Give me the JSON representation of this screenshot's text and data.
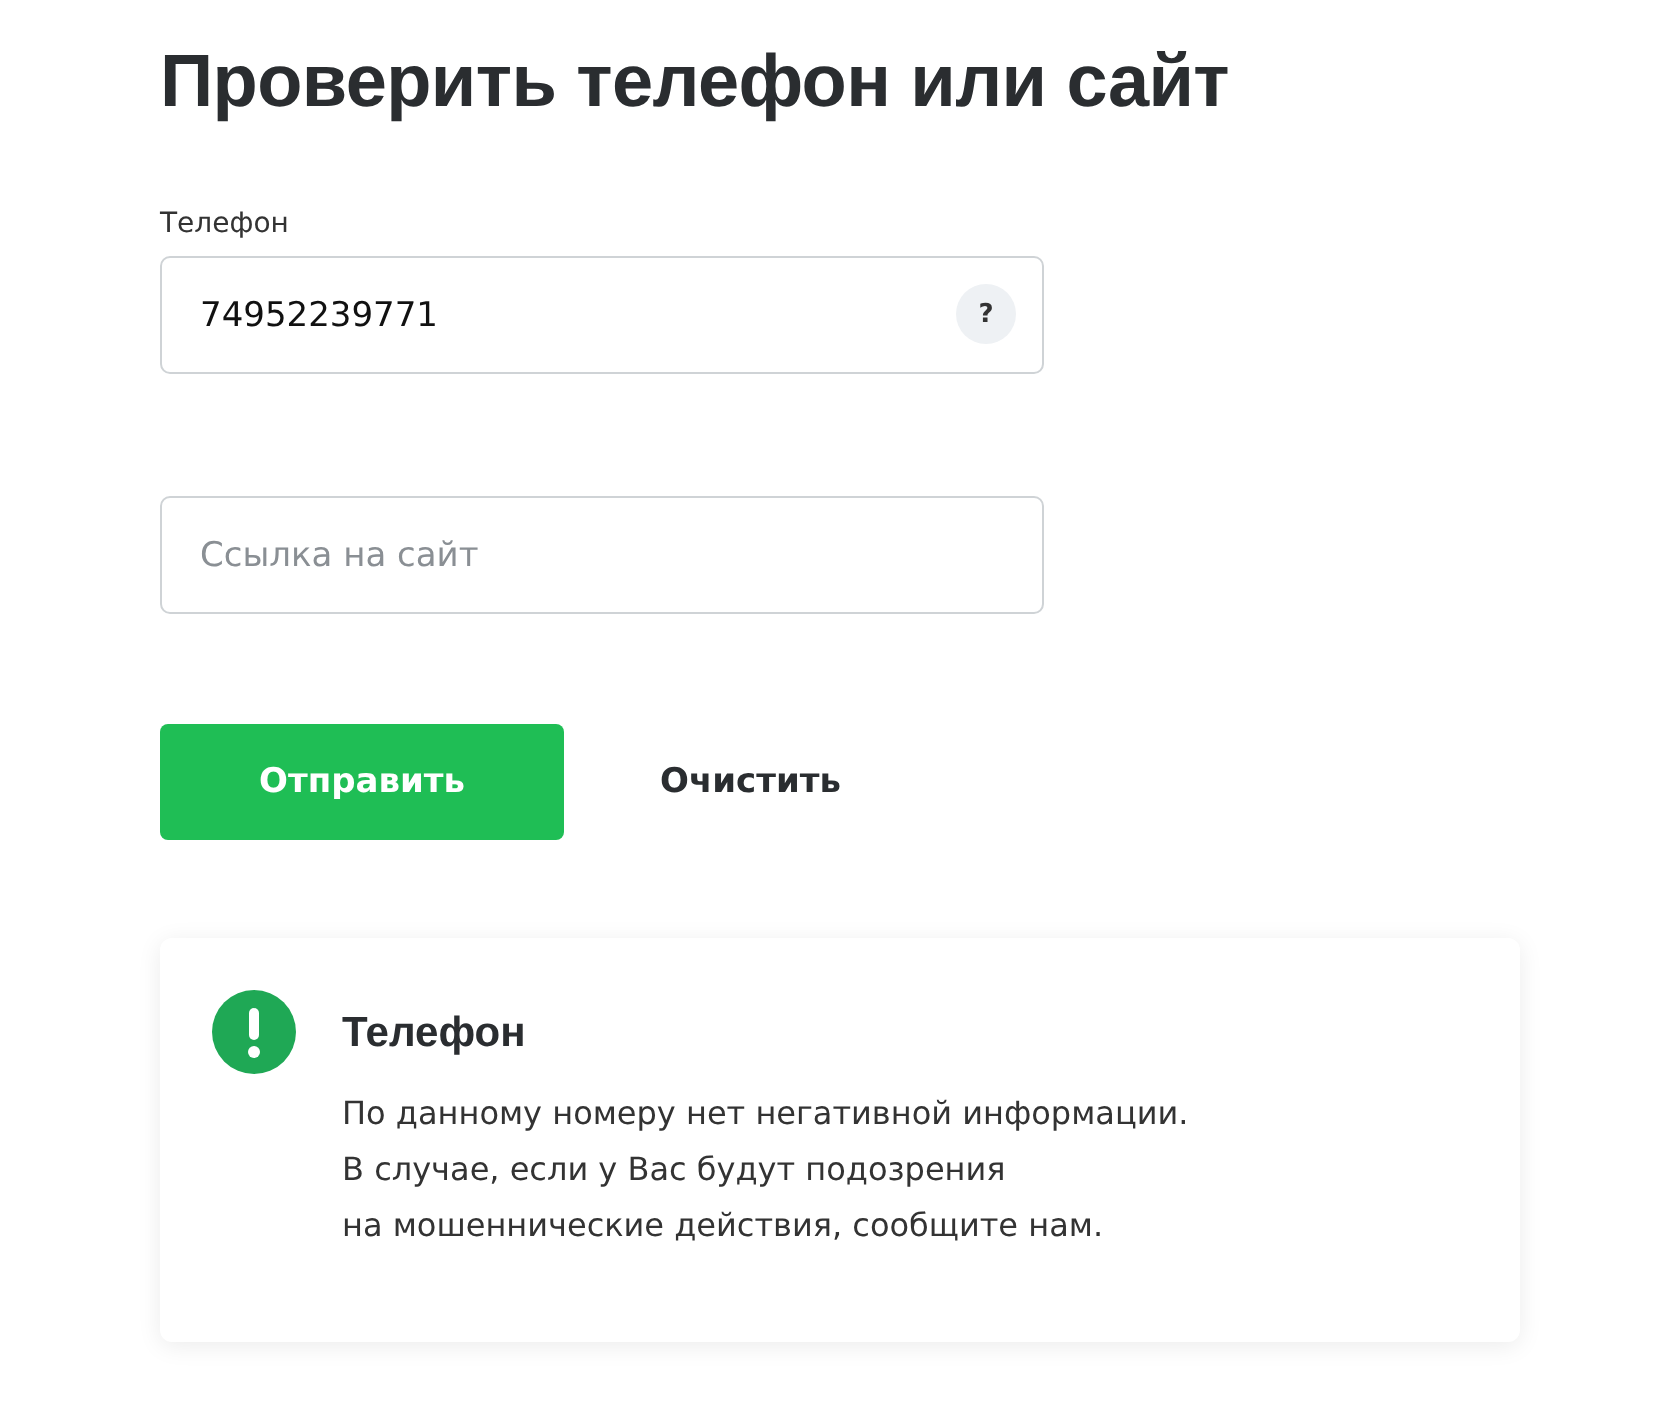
{
  "title": "Проверить телефон или сайт",
  "phone_field": {
    "label": "Телефон",
    "value": "74952239771",
    "help": "?"
  },
  "site_field": {
    "placeholder": "Ссылка на сайт"
  },
  "buttons": [
    {
      "kind": "primary",
      "label": "Отправить"
    },
    {
      "kind": "plain",
      "label": "Очистить"
    }
  ],
  "result": {
    "title": "Телефон",
    "lines": [
      "По данному номеру нет негативной информации.",
      "В случае, если у Вас будут подозрения",
      "на мошеннические действия, сообщите нам."
    ]
  }
}
